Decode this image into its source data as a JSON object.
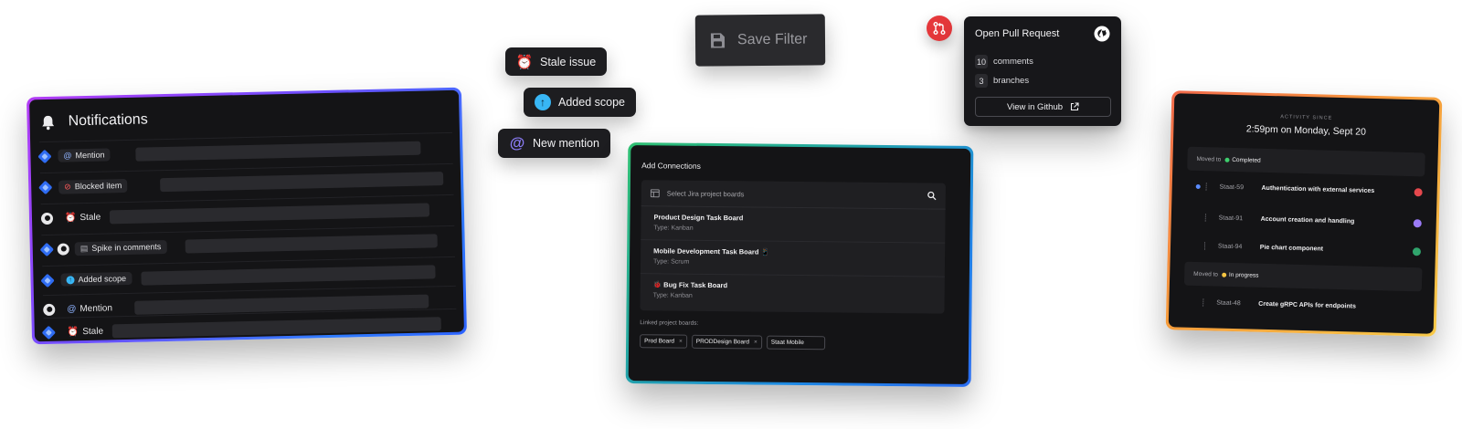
{
  "notifications": {
    "title": "Notifications",
    "rows": [
      {
        "source": "jira",
        "label": "Mention",
        "prefix": "@"
      },
      {
        "source": "jira",
        "label": "Blocked item",
        "prefix": "⊘"
      },
      {
        "source": "github",
        "label": "Stale",
        "prefix": "⏰"
      },
      {
        "source": "jira+github",
        "label": "Spike in comments",
        "prefix": "💬"
      },
      {
        "source": "jira",
        "label": "Added scope",
        "prefix": "↑"
      },
      {
        "source": "github",
        "label": "Mention",
        "prefix": "@"
      },
      {
        "source": "jira",
        "label": "Stale",
        "prefix": "⏰"
      }
    ]
  },
  "chips": {
    "stale_issue": "Stale issue",
    "added_scope": "Added scope",
    "new_mention": "New mention"
  },
  "save_filter": {
    "label": "Save Filter"
  },
  "pull_request": {
    "title": "Open Pull Request",
    "comments_count": "10",
    "comments_label": "comments",
    "branches_count": "3",
    "branches_label": "branches",
    "view_button": "View in Github"
  },
  "connections": {
    "title": "Add Connections",
    "search_placeholder": "Select Jira project boards",
    "boards": [
      {
        "name": "Product Design Task Board",
        "type": "Type: Kanban",
        "emoji": ""
      },
      {
        "name": "Mobile Development Task Board",
        "type": "Type: Scrum",
        "emoji": "📱"
      },
      {
        "name": "Bug Fix Task Board",
        "type": "Type: Kanban",
        "emoji": "🐞"
      }
    ],
    "linked_label": "Linked project boards:",
    "linked": [
      "Prod Board",
      "PRODDesign Board"
    ],
    "linked_input": "Staat Mobile"
  },
  "activity": {
    "since_label": "ACTIVITY SINCE",
    "time": "2:59pm on Monday, Sept 20",
    "moved_to_label": "Moved to",
    "groups": [
      {
        "status": "Completed",
        "status_color": "#3ecf6e",
        "issues": [
          {
            "id": "Staat-59",
            "title": "Authentication with external services",
            "avatar_color": "#e5484d"
          },
          {
            "id": "Staat-91",
            "title": "Account creation and handling",
            "avatar_color": "#9b7bf7"
          },
          {
            "id": "Staat-94",
            "title": "Pie chart component",
            "avatar_color": "#30a46c"
          }
        ]
      },
      {
        "status": "In progress",
        "status_color": "#f5c542",
        "issues": [
          {
            "id": "Staat-48",
            "title": "Create gRPC APIs for endpoints",
            "avatar_color": ""
          }
        ]
      }
    ]
  },
  "colors": {
    "jira_blue": "#2f6cf2",
    "danger_red": "#e5383b",
    "scope_blue": "#38b6f5",
    "alarm_yellow": "#f2b63a",
    "mention_purple": "#8b7cf6"
  }
}
